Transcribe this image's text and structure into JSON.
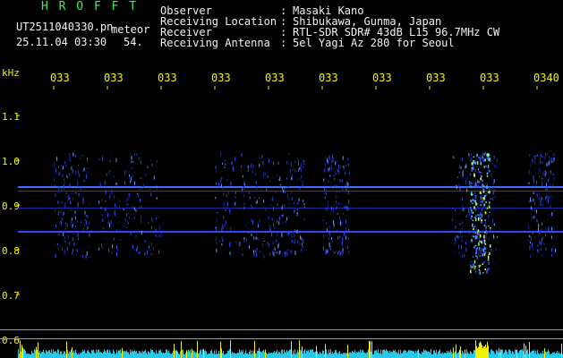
{
  "app": {
    "title": "H R O F F T",
    "filename": "UT2511040330.pn",
    "type_label": "meteor",
    "datetime": "25.11.04 03:30",
    "extra": "54."
  },
  "info": {
    "rows": [
      {
        "label": "Observer",
        "sep": ":",
        "value": "Masaki Kano"
      },
      {
        "label": "Receiving Location",
        "sep": ":",
        "value": "Shibukawa, Gunma, Japan"
      },
      {
        "label": "Receiver",
        "sep": ":",
        "value": "RTL-SDR SDR# 43dB L15 96.7MHz CW"
      },
      {
        "label": "Receiving Antenna",
        "sep": ":",
        "value": "5el Yagi Az 280 for Seoul"
      }
    ]
  },
  "axis": {
    "unit": "kHz",
    "y_ticks": [
      "1.1",
      "1.0",
      "0.9",
      "0.8",
      "0.7",
      "0.6"
    ],
    "x_ticks": [
      "033",
      "033",
      "033",
      "033",
      "033",
      "033",
      "033",
      "033",
      "033",
      "0340"
    ]
  },
  "colors": {
    "title": "#3ff04a",
    "text": "#f2f2f2",
    "axis": "#f2f200",
    "signal": "#2a4cff",
    "background": "#000000"
  }
}
